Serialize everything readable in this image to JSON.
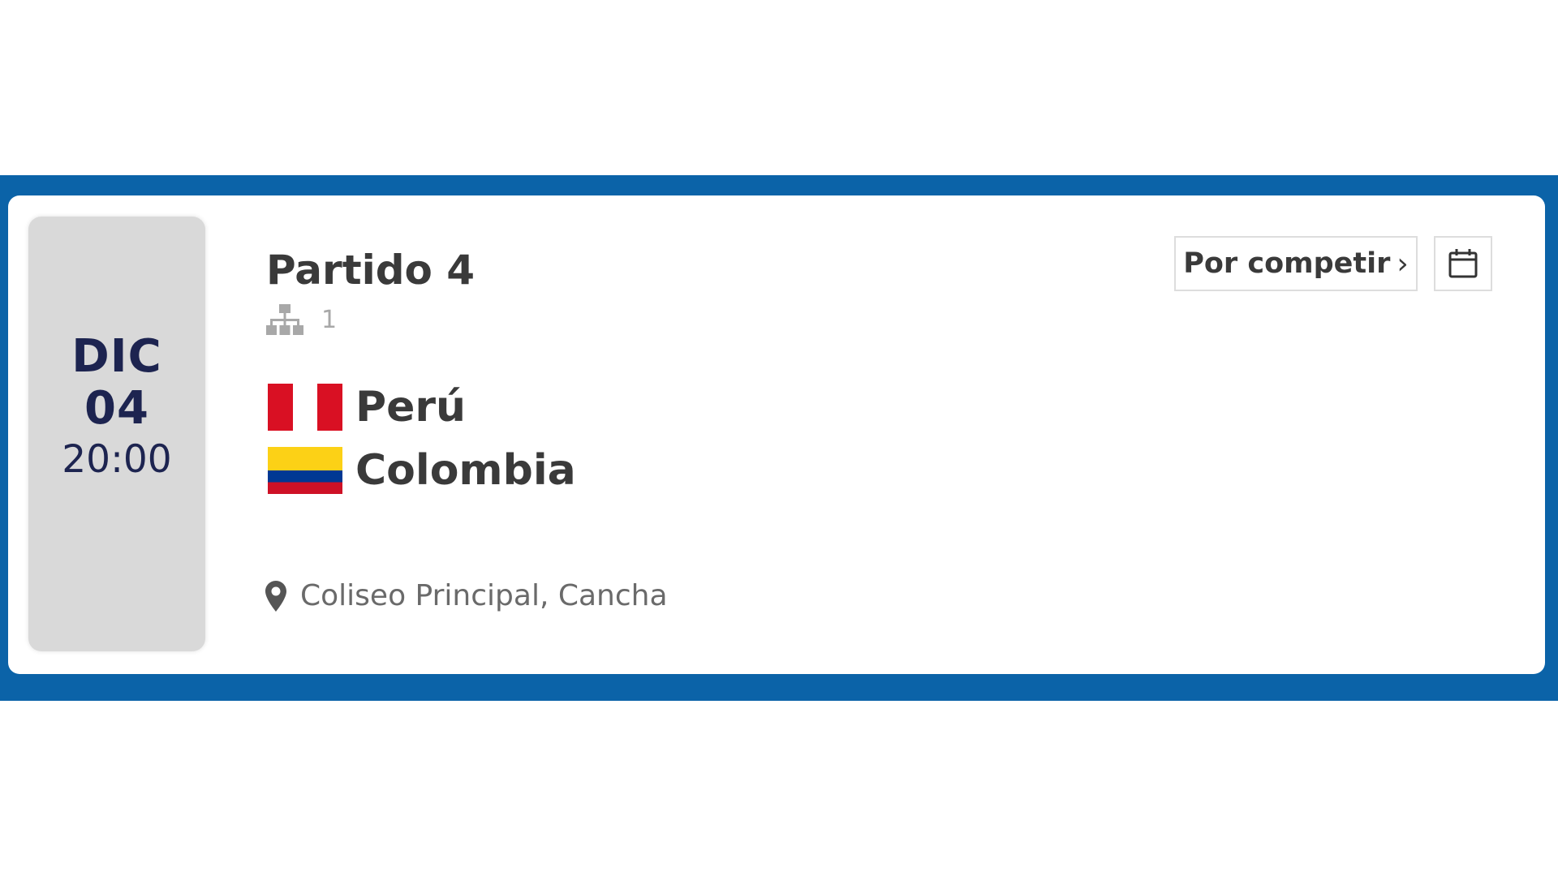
{
  "date": {
    "month": "DIC",
    "day": "04",
    "time": "20:00"
  },
  "match": {
    "title": "Partido 4",
    "bracket_icon": "bracket-icon",
    "bracket_number": "1"
  },
  "teams": [
    {
      "name": "Perú",
      "flag": "peru-flag",
      "flag_colors": [
        "#d91023",
        "#ffffff",
        "#d91023"
      ]
    },
    {
      "name": "Colombia",
      "flag": "colombia-flag",
      "flag_colors": [
        "#fcd116",
        "#003893",
        "#ce1126"
      ]
    }
  ],
  "venue": {
    "icon": "location-pin-icon",
    "text": "Coliseo Principal, Cancha"
  },
  "actions": {
    "status_label": "Por competir",
    "status_icon": "chevron-right-icon",
    "calendar_icon": "calendar-icon"
  },
  "colors": {
    "band": "#0b63a8",
    "date_text": "#1d2450",
    "date_panel": "#d9d9d9"
  }
}
